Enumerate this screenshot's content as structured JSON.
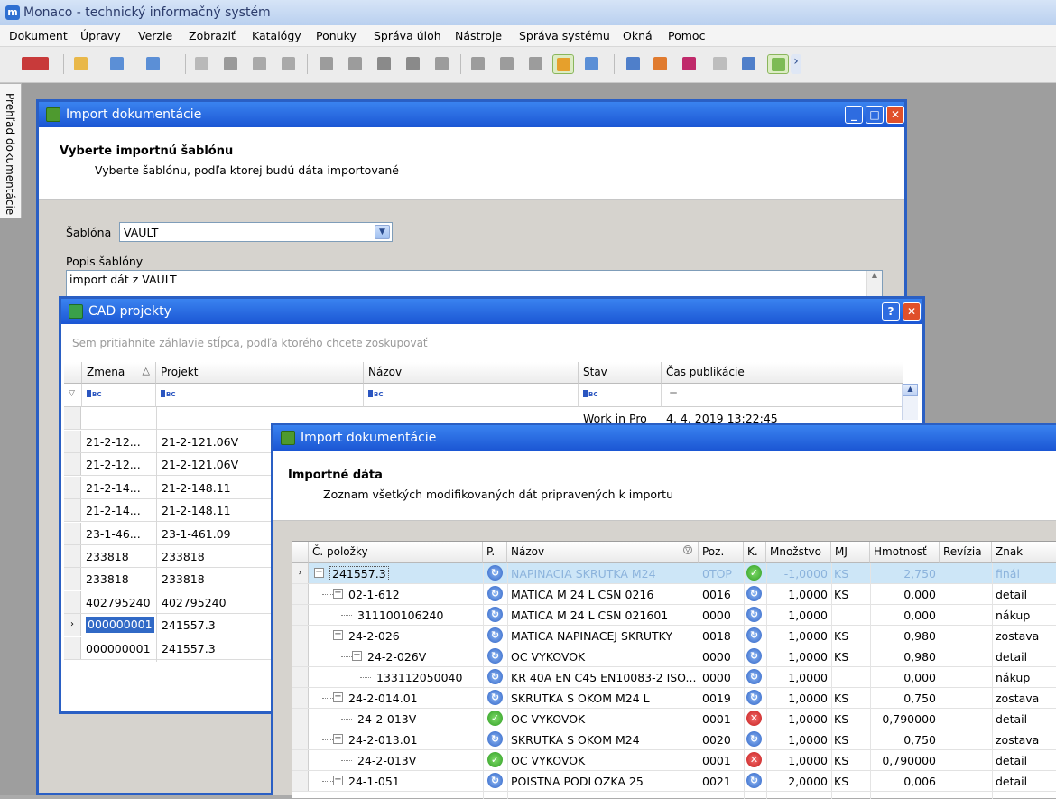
{
  "app": {
    "title": "Monaco - technický informačný systém",
    "logo": "m",
    "side_tab": "Prehľad dokumentácie"
  },
  "menu": [
    "Dokument",
    "Úpravy",
    "Verzie",
    "Zobraziť",
    "Katalógy",
    "Ponuky",
    "Správa úloh",
    "Nástroje",
    "Správa systému",
    "Okná",
    "Pomoc"
  ],
  "toolbar_icons": [
    "flag-dropdown-icon",
    "new-document-icon",
    "open-icon",
    "window-icon",
    "lock-icon",
    "save-icon",
    "refresh-icon",
    "undo-icon",
    "copy-icon",
    "paste-icon",
    "tools-icon",
    "tools2-icon",
    "user-icon",
    "search-icon",
    "preview-icon",
    "print-icon",
    "import-icon",
    "card-icon",
    "table-icon",
    "users-icon",
    "mx-icon",
    "report-icon",
    "layout-icon",
    "grid-icon",
    "more-icon"
  ],
  "dialog1": {
    "title": "Import dokumentácie",
    "header_title": "Vyberte importnú šablónu",
    "header_sub": "Vyberte šablónu, podľa ktorej budú dáta importované",
    "template_label": "Šablóna",
    "template_value": "VAULT",
    "desc_label": "Popis šablóny",
    "desc_value": "import dát z VAULT"
  },
  "cad": {
    "title": "CAD projekty",
    "group_hint": "Sem pritiahnite záhlavie stĺpca, podľa ktorého chcete zoskupovať",
    "columns": [
      "Zmena",
      "Projekt",
      "Názov",
      "Stav",
      "Čas publikácie"
    ],
    "sort_indicator": "△",
    "filter_eq": "=",
    "first_row": {
      "stav": "Work in Pro",
      "cas": "4. 4. 2019 13:22:45"
    },
    "rows": [
      [
        "21-2-12...",
        "21-2-121.06V"
      ],
      [
        "21-2-12...",
        "21-2-121.06V"
      ],
      [
        "21-2-14...",
        "21-2-148.11"
      ],
      [
        "21-2-14...",
        "21-2-148.11"
      ],
      [
        "23-1-46...",
        "23-1-461.09"
      ],
      [
        "233818",
        "233818"
      ],
      [
        "233818",
        "233818"
      ],
      [
        "402795240",
        "402795240"
      ],
      [
        "000000001",
        "241557.3"
      ],
      [
        "000000001",
        "241557.3"
      ]
    ],
    "selected_index": 8
  },
  "dialog3": {
    "title": "Import dokumentácie",
    "header_title": "Importné dáta",
    "header_sub": "Zoznam všetkých modifikovaných dát pripravených k importu",
    "columns": [
      "Č. položky",
      "P.",
      "Názov",
      "Poz.",
      "K.",
      "Množstvo",
      "MJ",
      "Hmotnosť",
      "Revízia",
      "Znak"
    ],
    "rows": [
      {
        "item": "241557.3",
        "level": 0,
        "exp": "minus",
        "p": "blue",
        "name": "NAPINACIA SKRUTKA M24",
        "poz": "0TOP",
        "k": "green",
        "qty": "-1,0000",
        "mj": "KS",
        "mass": "2,750",
        "rev": "",
        "znak": "finál",
        "selected": true
      },
      {
        "item": "02-1-612",
        "level": 1,
        "exp": "minus",
        "p": "blue",
        "name": "MATICA M 24 L    CSN 0216",
        "poz": "0016",
        "k": "blue",
        "qty": "1,0000",
        "mj": "KS",
        "mass": "0,000",
        "rev": "",
        "znak": "detail"
      },
      {
        "item": "311100106240",
        "level": 2,
        "exp": "",
        "p": "blue",
        "name": "MATICA M 24 L    CSN 021601",
        "poz": "0000",
        "k": "blue",
        "qty": "1,0000",
        "mj": "",
        "mass": "0,000",
        "rev": "",
        "znak": "nákup"
      },
      {
        "item": "24-2-026",
        "level": 1,
        "exp": "minus",
        "p": "blue",
        "name": "MATICA NAPINACEJ SKRUTKY",
        "poz": "0018",
        "k": "blue",
        "qty": "1,0000",
        "mj": "KS",
        "mass": "0,980",
        "rev": "",
        "znak": "zostava"
      },
      {
        "item": "24-2-026V",
        "level": 2,
        "exp": "minus",
        "p": "blue",
        "name": "OC VYKOVOK",
        "poz": "0000",
        "k": "blue",
        "qty": "1,0000",
        "mj": "KS",
        "mass": "0,980",
        "rev": "",
        "znak": "detail"
      },
      {
        "item": "133112050040",
        "level": 3,
        "exp": "",
        "p": "blue",
        "name": "KR 40A  EN C45 EN10083-2 ISO...",
        "poz": "0000",
        "k": "blue",
        "qty": "1,0000",
        "mj": "",
        "mass": "0,000",
        "rev": "",
        "znak": "nákup"
      },
      {
        "item": "24-2-014.01",
        "level": 1,
        "exp": "minus",
        "p": "blue",
        "name": "SKRUTKA S OKOM M24 L",
        "poz": "0019",
        "k": "blue",
        "qty": "1,0000",
        "mj": "KS",
        "mass": "0,750",
        "rev": "",
        "znak": "zostava"
      },
      {
        "item": "24-2-013V",
        "level": 2,
        "exp": "",
        "p": "green",
        "name": "OC VYKOVOK",
        "poz": "0001",
        "k": "red",
        "qty": "1,0000",
        "mj": "KS",
        "mass": "0,790000",
        "rev": "",
        "znak": "detail"
      },
      {
        "item": "24-2-013.01",
        "level": 1,
        "exp": "minus",
        "p": "blue",
        "name": "SKRUTKA S OKOM M24",
        "poz": "0020",
        "k": "blue",
        "qty": "1,0000",
        "mj": "KS",
        "mass": "0,750",
        "rev": "",
        "znak": "zostava"
      },
      {
        "item": "24-2-013V",
        "level": 2,
        "exp": "",
        "p": "green",
        "name": "OC VYKOVOK",
        "poz": "0001",
        "k": "red",
        "qty": "1,0000",
        "mj": "KS",
        "mass": "0,790000",
        "rev": "",
        "znak": "detail"
      },
      {
        "item": "24-1-051",
        "level": 1,
        "exp": "minus",
        "p": "blue",
        "name": "POISTNA PODLOZKA 25",
        "poz": "0021",
        "k": "blue",
        "qty": "2,0000",
        "mj": "KS",
        "mass": "0,006",
        "rev": "",
        "znak": "detail"
      }
    ]
  },
  "colors": {
    "title_bar": "#1b56d4",
    "selection": "#cde6f7",
    "status_ok": "#2f9c22",
    "status_error": "#c51d1d",
    "status_info": "#2f63c6"
  }
}
